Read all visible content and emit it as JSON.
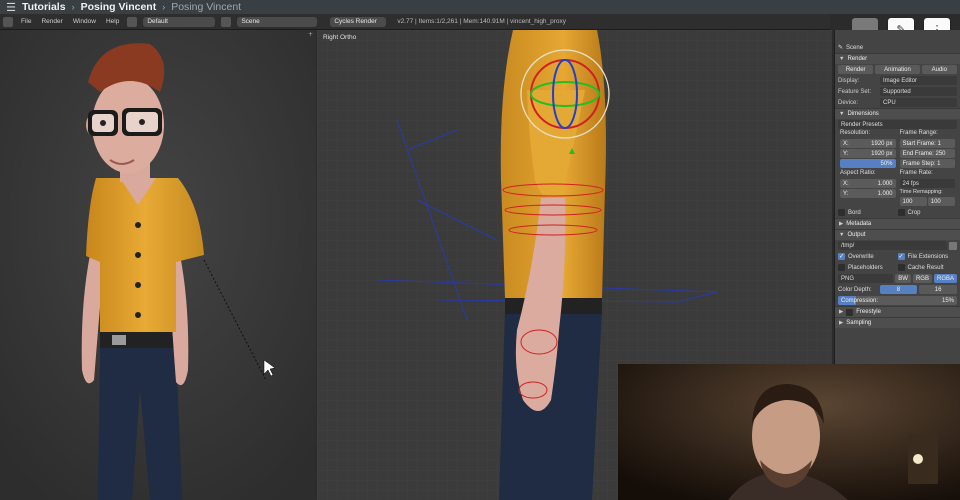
{
  "header": {
    "crumbs": [
      "Tutorials",
      "Posing Vincent",
      "Posing Vincent"
    ]
  },
  "infobar": {
    "menus": [
      "File",
      "Render",
      "Window",
      "Help"
    ],
    "layout": "Default",
    "scene": "Scene",
    "engine": "Cycles Render",
    "stats": "v2.77 | Items:1/2,261 | Mem:140.91M | vincent_high_proxy"
  },
  "viewport": {
    "right_label": "Right Ortho"
  },
  "props": {
    "scene_label": "Scene",
    "render_header": "Render",
    "render_buttons": [
      "Render",
      "Animation",
      "Audio"
    ],
    "display_label": "Display:",
    "display_value": "Image Editor",
    "feature_label": "Feature Set:",
    "feature_value": "Supported",
    "device_label": "Device:",
    "device_value": "CPU",
    "dimensions_header": "Dimensions",
    "presets": "Render Presets",
    "resolution_label": "Resolution:",
    "res_x": "1920 px",
    "res_y": "1920 px",
    "res_pct": "50%",
    "frame_range_label": "Frame Range:",
    "start_frame": "Start Frame: 1",
    "end_frame": "End Frame: 250",
    "frame_step": "Frame Step: 1",
    "aspect_label": "Aspect Ratio:",
    "aspect_x": "1.000",
    "aspect_y": "1.000",
    "frame_rate_label": "Frame Rate:",
    "frame_rate": "24 fps",
    "time_remap_label": "Time Remapping:",
    "remap_old": "100",
    "remap_new": "100",
    "border_label": "Bord",
    "crop_label": "Crop",
    "metadata_header": "Metadata",
    "output_header": "Output",
    "output_path": "/tmp/",
    "overwrite": "Overwrite",
    "file_ext": "File Extensions",
    "placeholders": "Placeholders",
    "cache_result": "Cache Result",
    "format": "PNG",
    "bw": "BW",
    "rgb": "RGB",
    "rgba": "RGBA",
    "color_depth_label": "Color Depth:",
    "depth_8": "8",
    "depth_16": "16",
    "compression_label": "Compression:",
    "compression_value": "15%",
    "freestyle_header": "Freestyle",
    "sampling_header": "Sampling"
  },
  "colors": {
    "accent": "#5680c2",
    "shirt": "#e0a431",
    "jeans": "#1f2c44"
  }
}
